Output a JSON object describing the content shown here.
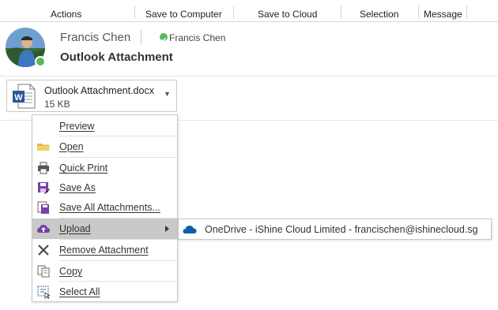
{
  "ribbon": {
    "tabs": [
      "Actions",
      "Save to Computer",
      "Save to Cloud",
      "Selection",
      "Message"
    ]
  },
  "message": {
    "sender": "Francis Chen",
    "recipient": "Francis Chen",
    "subject": "Outlook Attachment"
  },
  "attachment": {
    "file_name": "Outlook Attachment.docx",
    "file_size": "15 KB",
    "icon": "word-document-icon"
  },
  "context_menu": {
    "items": [
      {
        "label": "Preview",
        "icon": "preview"
      },
      {
        "label": "Open",
        "icon": "folder-icon"
      },
      {
        "label": "Quick Print",
        "icon": "printer-icon"
      },
      {
        "label": "Save As",
        "icon": "save-as-icon"
      },
      {
        "label": "Save All Attachments...",
        "icon": "save-all-icon"
      },
      {
        "label": "Upload",
        "icon": "upload-cloud-icon"
      },
      {
        "label": "Remove Attachment",
        "icon": "remove-x-icon"
      },
      {
        "label": "Copy",
        "icon": "copy-icon"
      },
      {
        "label": "Select All",
        "icon": "select-all-icon"
      }
    ]
  },
  "upload_submenu": {
    "label": "OneDrive - iShine Cloud Limited - francischen@ishinecloud.sg",
    "icon": "onedrive-cloud-icon"
  },
  "colors": {
    "presence_green": "#5cb85c",
    "hover_gray": "#c9c9c9",
    "word_blue": "#2b579a",
    "onedrive_blue": "#0f5fa8"
  }
}
